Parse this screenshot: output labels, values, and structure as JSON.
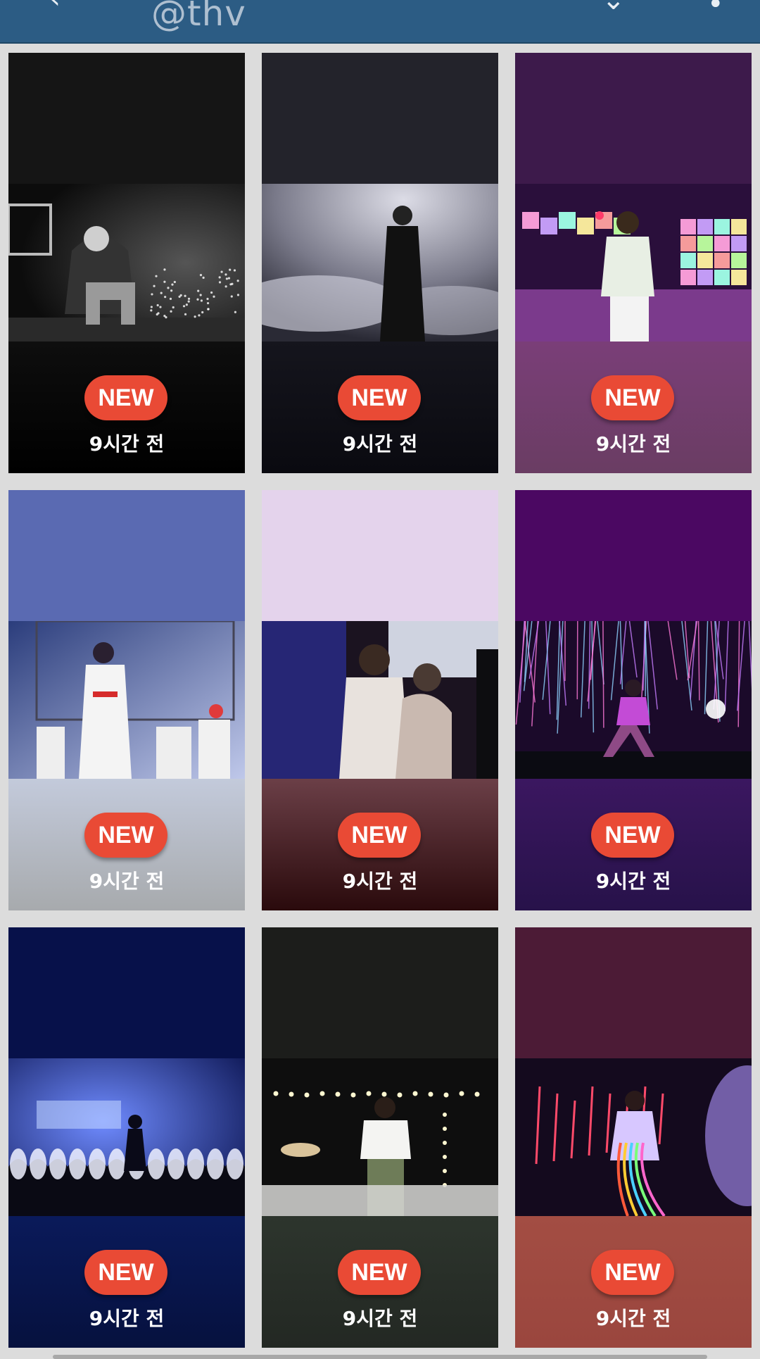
{
  "header": {
    "handle": "@thv"
  },
  "tiles": [
    {
      "badge": "NEW",
      "time": "9시간 전",
      "top": "#151515",
      "bottom_top": "#0e0e0e",
      "bottom_bottom": "#000000",
      "scene": "bw"
    },
    {
      "badge": "NEW",
      "time": "9시간 전",
      "top": "#23232b",
      "bottom_top": "#15151d",
      "bottom_bottom": "#0a0a10",
      "scene": "smoke"
    },
    {
      "badge": "NEW",
      "time": "9시간 전",
      "top": "#3d1a4b",
      "bottom_top": "#7a3e78",
      "bottom_bottom": "#6a3d63",
      "scene": "neon"
    },
    {
      "badge": "NEW",
      "time": "9시간 전",
      "top": "#5a6ab2",
      "bottom_top": "#c3cadb",
      "bottom_bottom": "#a7aaad",
      "scene": "blue-stage"
    },
    {
      "badge": "NEW",
      "time": "9시간 전",
      "top": "#e4d3ec",
      "bottom_top": "#6b3f47",
      "bottom_bottom": "#2a0a0c",
      "scene": "crowd"
    },
    {
      "badge": "NEW",
      "time": "9시간 전",
      "top": "#4b0862",
      "bottom_top": "#3b1760",
      "bottom_bottom": "#27124a",
      "scene": "fireworks"
    },
    {
      "badge": "NEW",
      "time": "9시간 전",
      "top": "#07114a",
      "bottom_top": "#0a1a5a",
      "bottom_bottom": "#06113e",
      "scene": "blue-dance"
    },
    {
      "badge": "NEW",
      "time": "9시간 전",
      "top": "#1c1d1b",
      "bottom_top": "#2d352d",
      "bottom_bottom": "#232823",
      "scene": "white-shirt"
    },
    {
      "badge": "NEW",
      "time": "9시간 전",
      "top": "#4c1b36",
      "bottom_top": "#a34d43",
      "bottom_bottom": "#9a463e",
      "scene": "ribbons"
    }
  ],
  "colors": {
    "header_bg": "#2c5c84",
    "badge_bg": "#e94a35",
    "page_bg": "#dcdcdc"
  }
}
